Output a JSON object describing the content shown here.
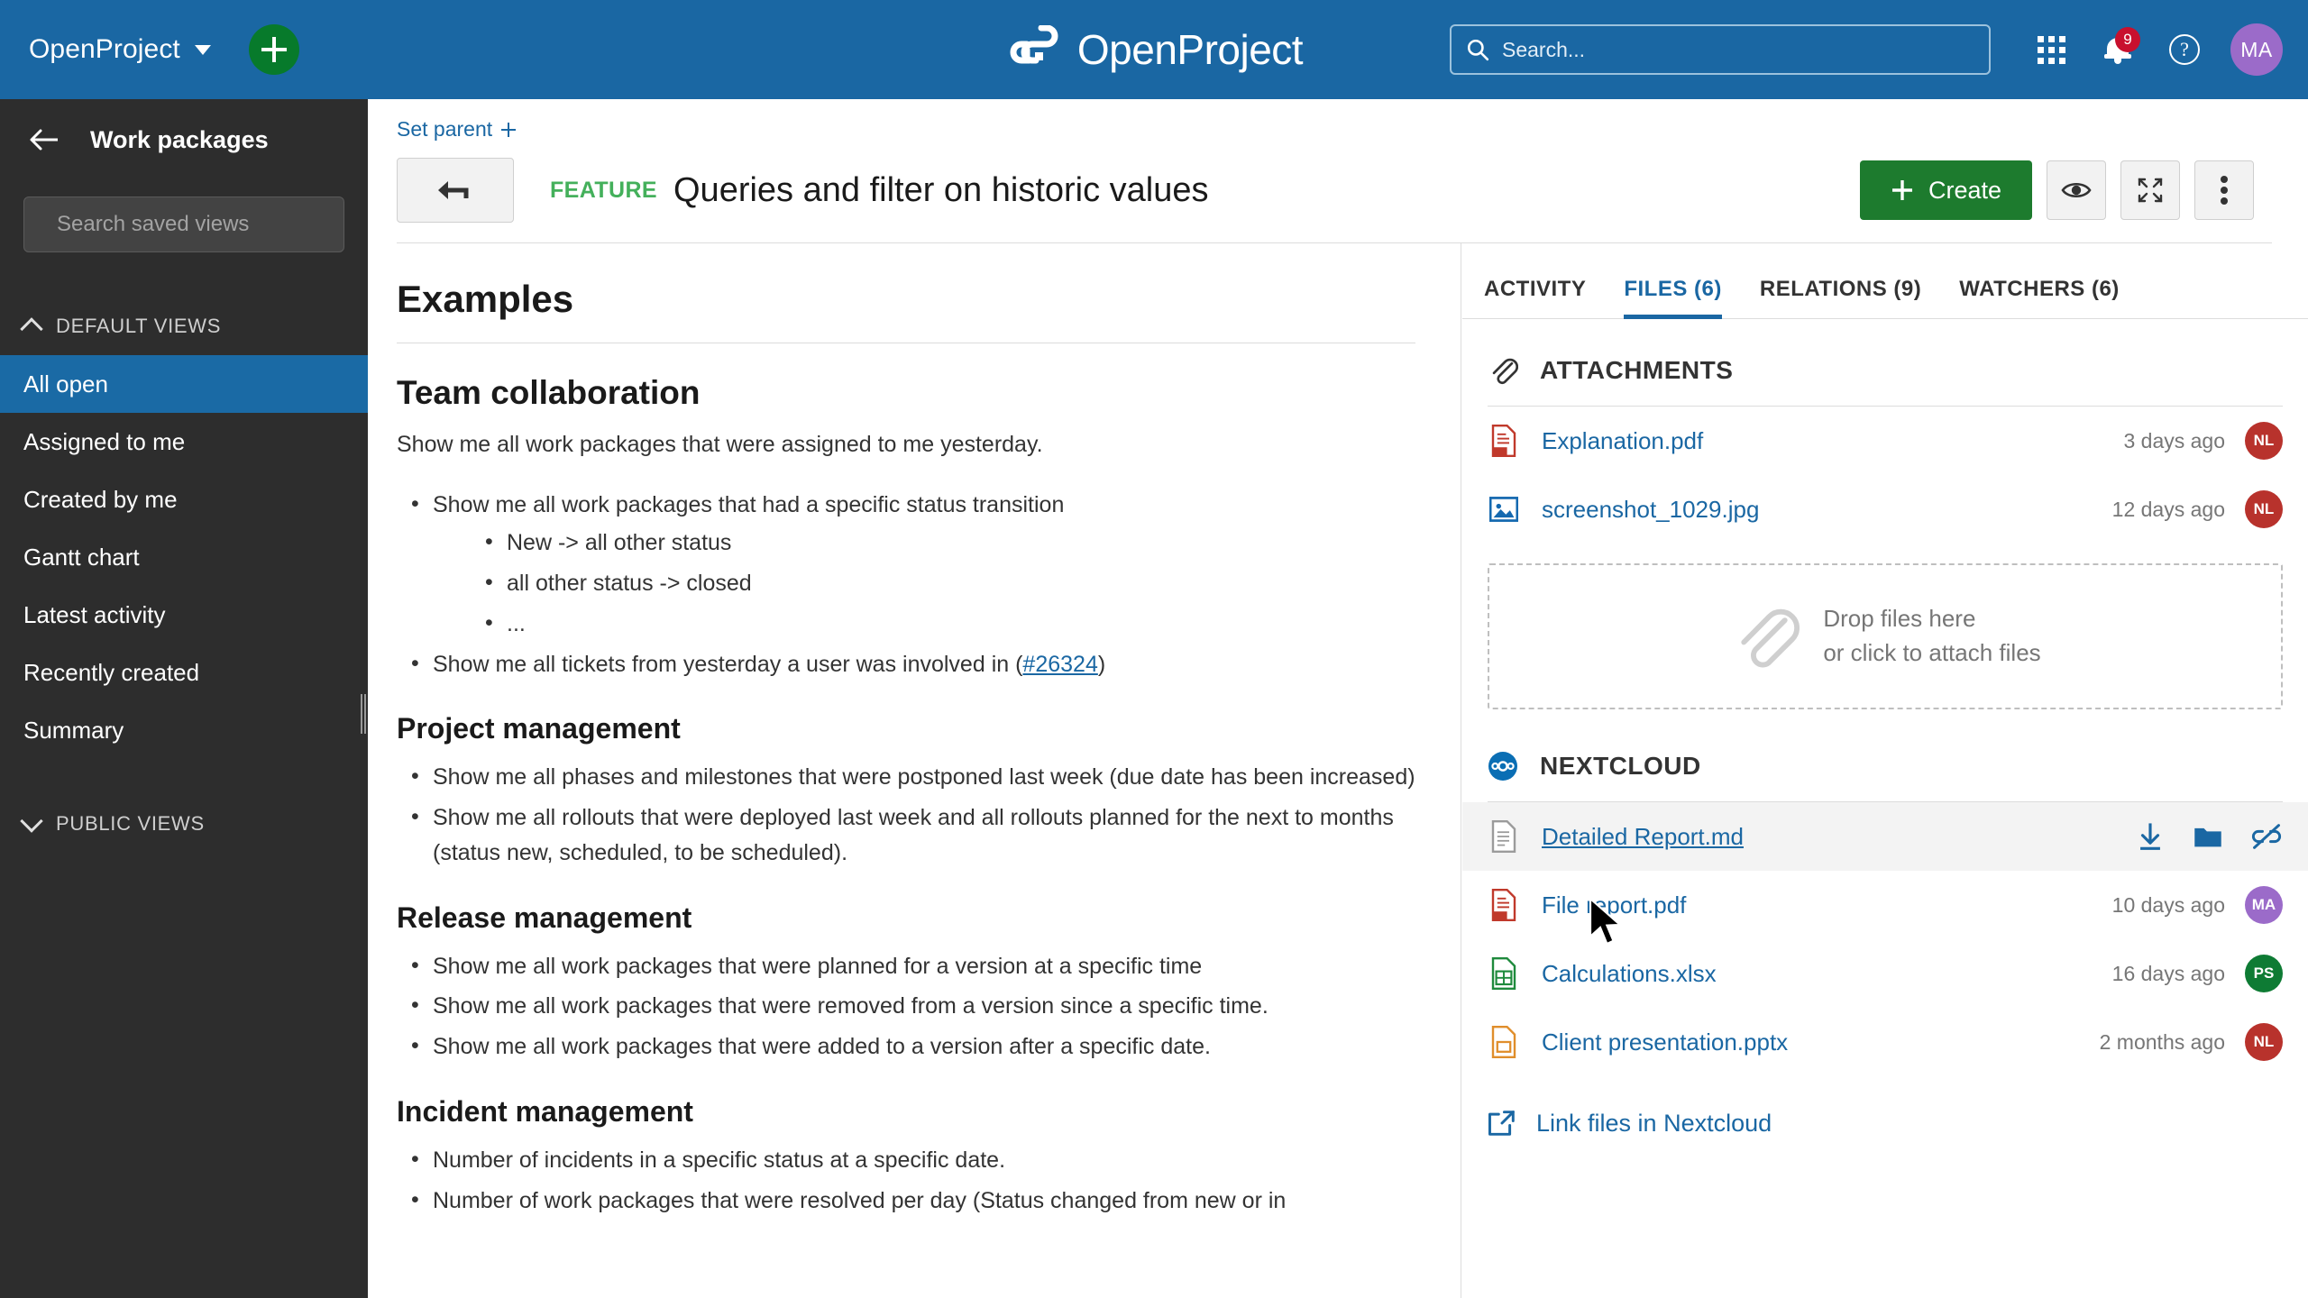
{
  "topbar": {
    "brand": "OpenProject",
    "logo_text": "OpenProject",
    "add_icon": "plus-icon",
    "search_placeholder": "Search...",
    "search_value": "",
    "modules_icon": "grid-modules-icon",
    "notifications_icon": "bell-icon",
    "notifications_count": "9",
    "help_icon": "help-icon",
    "help_label": "?",
    "avatar_initials": "MA",
    "colors": {
      "bar": "#1A67A3",
      "add_button": "#077A2B",
      "badge": "#C8102E",
      "avatar": "#9B6BC9"
    }
  },
  "sidebar": {
    "back_icon": "arrow-left-icon",
    "title": "Work packages",
    "search_placeholder": "Search saved views",
    "search_value": "",
    "sections": [
      {
        "label": "DEFAULT VIEWS",
        "state": "expanded",
        "chevron": "chevron-up-icon"
      },
      {
        "label": "PUBLIC VIEWS",
        "state": "collapsed",
        "chevron": "chevron-down-icon"
      }
    ],
    "items": [
      {
        "label": "All open",
        "active": true
      },
      {
        "label": "Assigned to me",
        "active": false
      },
      {
        "label": "Created by me",
        "active": false
      },
      {
        "label": "Gantt chart",
        "active": false
      },
      {
        "label": "Latest activity",
        "active": false
      },
      {
        "label": "Recently created",
        "active": false
      },
      {
        "label": "Summary",
        "active": false
      }
    ],
    "active_color": "#1A6AA5"
  },
  "work_package": {
    "set_parent_label": "Set parent",
    "set_parent_icon": "plus-icon",
    "back_icon": "back-arrow-icon",
    "type": "FEATURE",
    "type_color": "#44B05B",
    "subject": "Queries and filter on historic values",
    "create_label": "Create",
    "create_icon": "plus-icon",
    "watch_icon": "eye-icon",
    "fullscreen_icon": "fullscreen-icon",
    "more_icon": "more-vertical-icon"
  },
  "description": {
    "title": "Examples",
    "sections": [
      {
        "heading": "Team collaboration",
        "heading_level": 2,
        "paragraph": "Show me all work packages that were assigned to me yesterday.",
        "items": [
          {
            "text": "Show me all work packages that had a specific status transition",
            "children": [
              "New -> all other status",
              "all other status -> closed",
              "..."
            ]
          },
          {
            "text_before_link": "Show me all tickets from yesterday a user was involved in (",
            "link": "#26324",
            "text_after_link": ")"
          }
        ]
      },
      {
        "heading": "Project management",
        "heading_level": 3,
        "items": [
          {
            "text": "Show me all phases and milestones that were postponed last week (due date has been increased)"
          },
          {
            "text": "Show me all rollouts that were deployed last week and all rollouts planned for the next to months (status new, scheduled, to be scheduled)."
          }
        ]
      },
      {
        "heading": "Release management",
        "heading_level": 3,
        "items": [
          {
            "text": "Show me all work packages that were planned for a version at a specific time"
          },
          {
            "text": "Show me all work packages that were removed from a version since a specific time."
          },
          {
            "text": "Show me all work packages that were added to a version after a specific date."
          }
        ]
      },
      {
        "heading": "Incident management",
        "heading_level": 3,
        "items": [
          {
            "text": "Number of incidents in a specific status at a specific date."
          },
          {
            "text": "Number of work packages that were resolved per day (Status changed from new or in"
          }
        ]
      }
    ]
  },
  "right_panel": {
    "tabs": [
      {
        "label": "ACTIVITY",
        "active": false
      },
      {
        "label": "FILES (6)",
        "active": true
      },
      {
        "label": "RELATIONS (9)",
        "active": false
      },
      {
        "label": "WATCHERS (6)",
        "active": false
      }
    ],
    "attachments": {
      "icon": "paperclip-icon",
      "title": "ATTACHMENTS",
      "files": [
        {
          "name": "Explanation.pdf",
          "icon": "pdf-file-icon",
          "date": "3 days ago",
          "author": "NL",
          "author_color": "#B8322C"
        },
        {
          "name": "screenshot_1029.jpg",
          "icon": "image-file-icon",
          "date": "12 days ago",
          "author": "NL",
          "author_color": "#B8322C"
        }
      ],
      "dropzone": {
        "icon": "paperclip-icon",
        "line1": "Drop files here",
        "line2": "or click to attach files"
      }
    },
    "nextcloud": {
      "icon": "nextcloud-icon",
      "title": "NEXTCLOUD",
      "files": [
        {
          "name": "Detailed Report.md",
          "icon": "markdown-file-icon",
          "date": "",
          "author": "",
          "author_color": "",
          "hovered": true,
          "actions": [
            {
              "name": "download-icon",
              "label": "Download"
            },
            {
              "name": "open-folder-icon",
              "label": "Open folder"
            },
            {
              "name": "unlink-icon",
              "label": "Unlink"
            }
          ]
        },
        {
          "name": "File report.pdf",
          "icon": "pdf-file-icon",
          "date": "10 days ago",
          "author": "MA",
          "author_color": "#9B6BC9",
          "hovered": false
        },
        {
          "name": "Calculations.xlsx",
          "icon": "spreadsheet-file-icon",
          "date": "16 days ago",
          "author": "PS",
          "author_color": "#0E7B34",
          "hovered": false
        },
        {
          "name": "Client presentation.pptx",
          "icon": "presentation-file-icon",
          "date": "2 months ago",
          "author": "NL",
          "author_color": "#B8322C",
          "hovered": false
        }
      ],
      "link_label": "Link files in Nextcloud",
      "link_icon": "external-link-icon"
    }
  }
}
